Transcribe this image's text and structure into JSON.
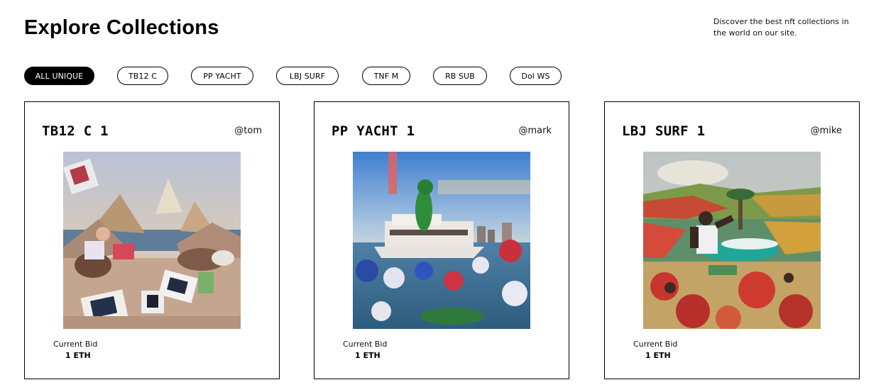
{
  "header": {
    "title": "Explore Collections",
    "tagline": "Discover the best nft collections in the world on our site."
  },
  "filters": [
    {
      "label": "ALL UNIQUE",
      "active": true
    },
    {
      "label": "TB12 C",
      "active": false
    },
    {
      "label": "PP YACHT",
      "active": false
    },
    {
      "label": "LBJ SURF",
      "active": false
    },
    {
      "label": "TNF M",
      "active": false
    },
    {
      "label": "RB SUB",
      "active": false
    },
    {
      "label": "Dol WS",
      "active": false
    }
  ],
  "cards": [
    {
      "title": "TB12 C 1",
      "owner": "@tom",
      "bid_label": "Current Bid",
      "bid_value": "1 ETH",
      "art": "tb12-painting"
    },
    {
      "title": "PP YACHT 1",
      "owner": "@mark",
      "bid_label": "Current Bid",
      "bid_value": "1 ETH",
      "art": "pp-yacht-painting"
    },
    {
      "title": "LBJ SURF 1",
      "owner": "@mike",
      "bid_label": "Current Bid",
      "bid_value": "1 ETH",
      "art": "lbj-surf-painting"
    }
  ]
}
